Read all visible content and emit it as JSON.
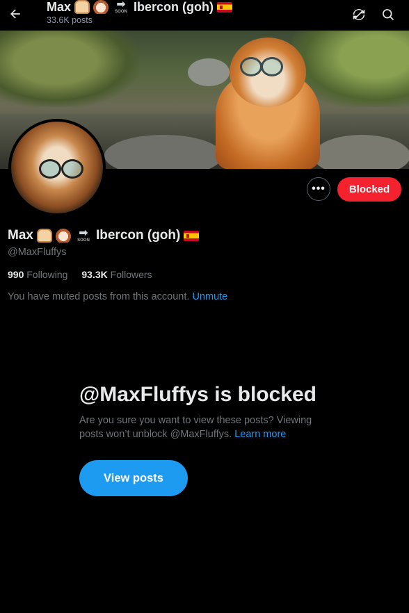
{
  "header": {
    "name_prefix": "Max",
    "soon_label": "SOON",
    "name_suffix": "Ibercon (goh)",
    "post_count": "33.6K posts",
    "back_icon": "arrow-left-icon",
    "refresh_icon": "refresh-icon",
    "search_icon": "search-icon"
  },
  "profile": {
    "name_prefix": "Max",
    "soon_label": "SOON",
    "name_suffix": "Ibercon (goh)",
    "handle": "@MaxFluffys",
    "following_count": "990",
    "following_label": "Following",
    "followers_count": "93.3K",
    "followers_label": "Followers",
    "muted_text": "You have muted posts from this account.",
    "unmute_label": "Unmute"
  },
  "actions": {
    "more_label": "•••",
    "blocked_label": "Blocked"
  },
  "blocked_notice": {
    "title": "@MaxFluffys is blocked",
    "description": "Are you sure you want to view these posts? Viewing posts won’t unblock @MaxFluffys.",
    "learn_more": "Learn more",
    "view_button": "View posts"
  },
  "colors": {
    "background": "#000000",
    "accent": "#1d9bf0",
    "blocked_red": "#f4212e",
    "muted_text": "#71767b"
  }
}
